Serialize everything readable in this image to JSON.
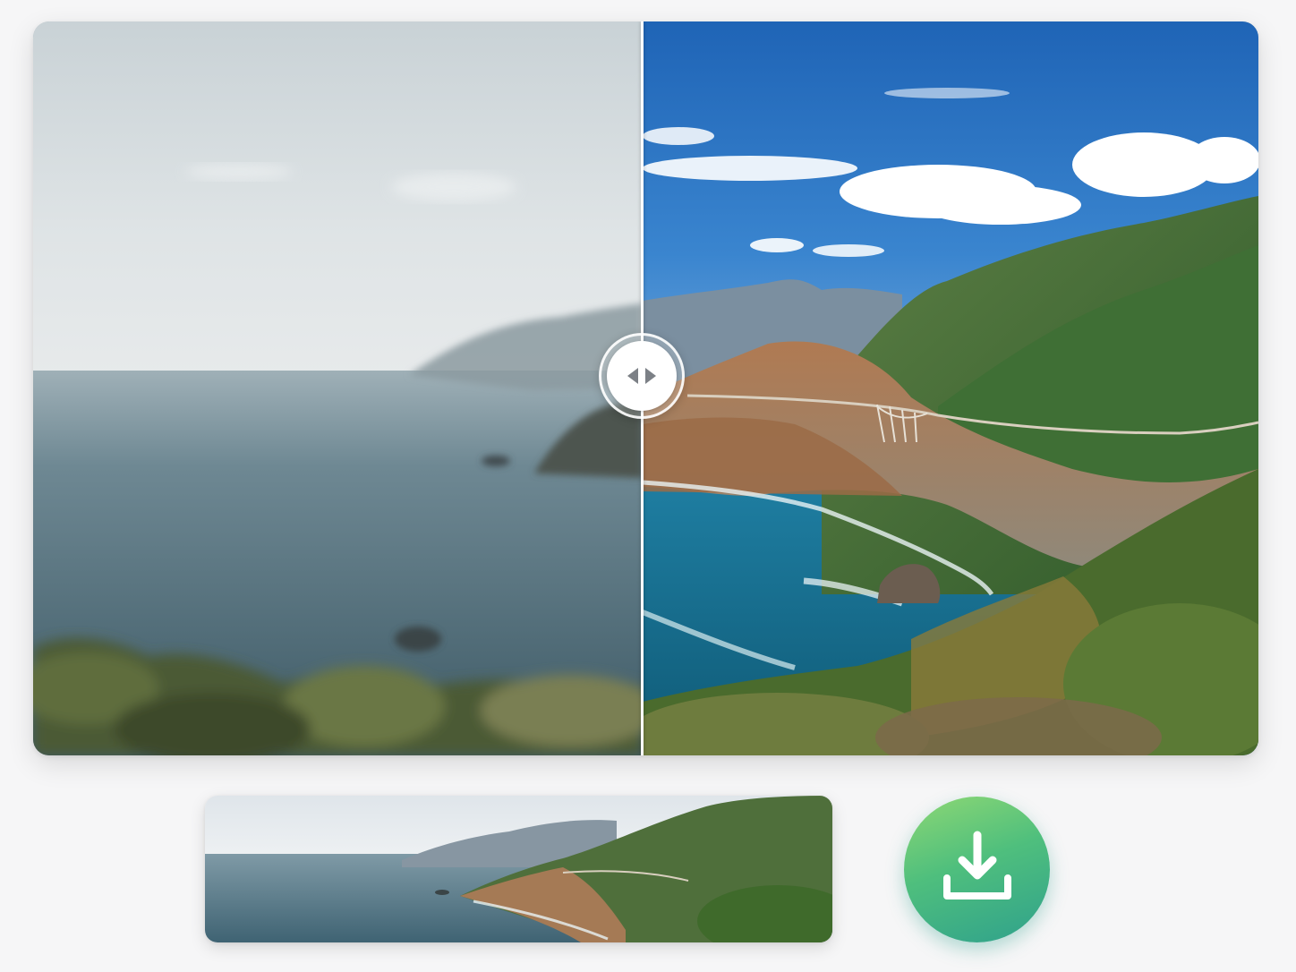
{
  "comparison": {
    "before_label": "",
    "after_label": "",
    "colors": {
      "before_sky": "#d3dadd",
      "before_sea": "#4b6a78",
      "after_sky": "#2f78c4",
      "after_sea": "#1b6f8c",
      "hills_green": "#3d6a33",
      "cliff_brown": "#9a6a4a"
    },
    "handle_icon": "left-right-arrows-icon"
  },
  "thumbnail": {
    "icon": "landscape-thumbnail"
  },
  "download": {
    "icon": "download-icon",
    "color_start": "#8ed874",
    "color_end": "#2fa18c"
  }
}
